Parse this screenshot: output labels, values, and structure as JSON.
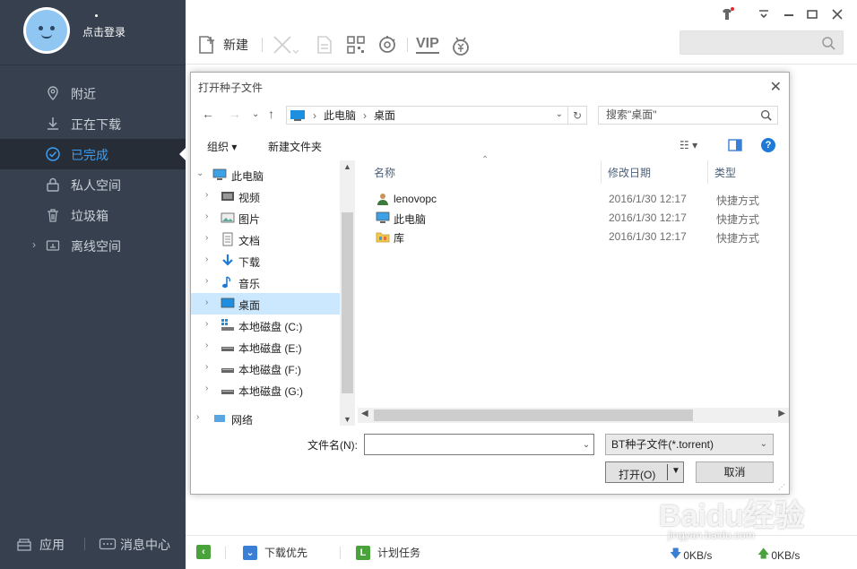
{
  "sidebar": {
    "login_label": "点击登录",
    "items": [
      {
        "label": "附近",
        "icon": "location-icon"
      },
      {
        "label": "正在下载",
        "icon": "download-icon"
      },
      {
        "label": "已完成",
        "icon": "check-circle-icon"
      },
      {
        "label": "私人空间",
        "icon": "lock-icon"
      },
      {
        "label": "垃圾箱",
        "icon": "trash-icon"
      },
      {
        "label": "离线空间",
        "icon": "cloud-icon"
      }
    ],
    "apps_label": "应用",
    "messages_label": "消息中心"
  },
  "toolbar": {
    "new_label": "新建",
    "vip_label": "VIP"
  },
  "statusbar": {
    "priority_label": "下载优先",
    "schedule_label": "计划任务",
    "down_speed": "0KB/s",
    "up_speed": "0KB/s"
  },
  "dialog": {
    "title": "打开种子文件",
    "breadcrumb": [
      "此电脑",
      "桌面"
    ],
    "search_placeholder": "搜索\"桌面\"",
    "organize_label": "组织",
    "new_folder_label": "新建文件夹",
    "tree": [
      {
        "label": "此电脑",
        "icon": "computer-icon",
        "expanded": true
      },
      {
        "label": "视频",
        "icon": "video-icon"
      },
      {
        "label": "图片",
        "icon": "pictures-icon"
      },
      {
        "label": "文档",
        "icon": "documents-icon"
      },
      {
        "label": "下载",
        "icon": "download-folder-icon"
      },
      {
        "label": "音乐",
        "icon": "music-icon"
      },
      {
        "label": "桌面",
        "icon": "desktop-icon",
        "selected": true
      },
      {
        "label": "本地磁盘 (C:)",
        "icon": "drive-c-icon"
      },
      {
        "label": "本地磁盘 (E:)",
        "icon": "drive-icon"
      },
      {
        "label": "本地磁盘 (F:)",
        "icon": "drive-icon"
      },
      {
        "label": "本地磁盘 (G:)",
        "icon": "drive-icon"
      },
      {
        "label": "网络",
        "icon": "network-icon"
      }
    ],
    "columns": {
      "name": "名称",
      "date": "修改日期",
      "type": "类型"
    },
    "files": [
      {
        "name": "lenovopc",
        "date": "2016/1/30 12:17",
        "type": "快捷方式",
        "icon": "user-folder-icon"
      },
      {
        "name": "此电脑",
        "date": "2016/1/30 12:17",
        "type": "快捷方式",
        "icon": "computer-icon"
      },
      {
        "name": "库",
        "date": "2016/1/30 12:17",
        "type": "快捷方式",
        "icon": "library-icon"
      }
    ],
    "filename_label": "文件名(N):",
    "filename_value": "",
    "filetype_value": "BT种子文件(*.torrent)",
    "open_label": "打开(O)",
    "cancel_label": "取消"
  },
  "watermark": {
    "text": "Baidu经验",
    "url": "jingyan.baidu.com"
  }
}
